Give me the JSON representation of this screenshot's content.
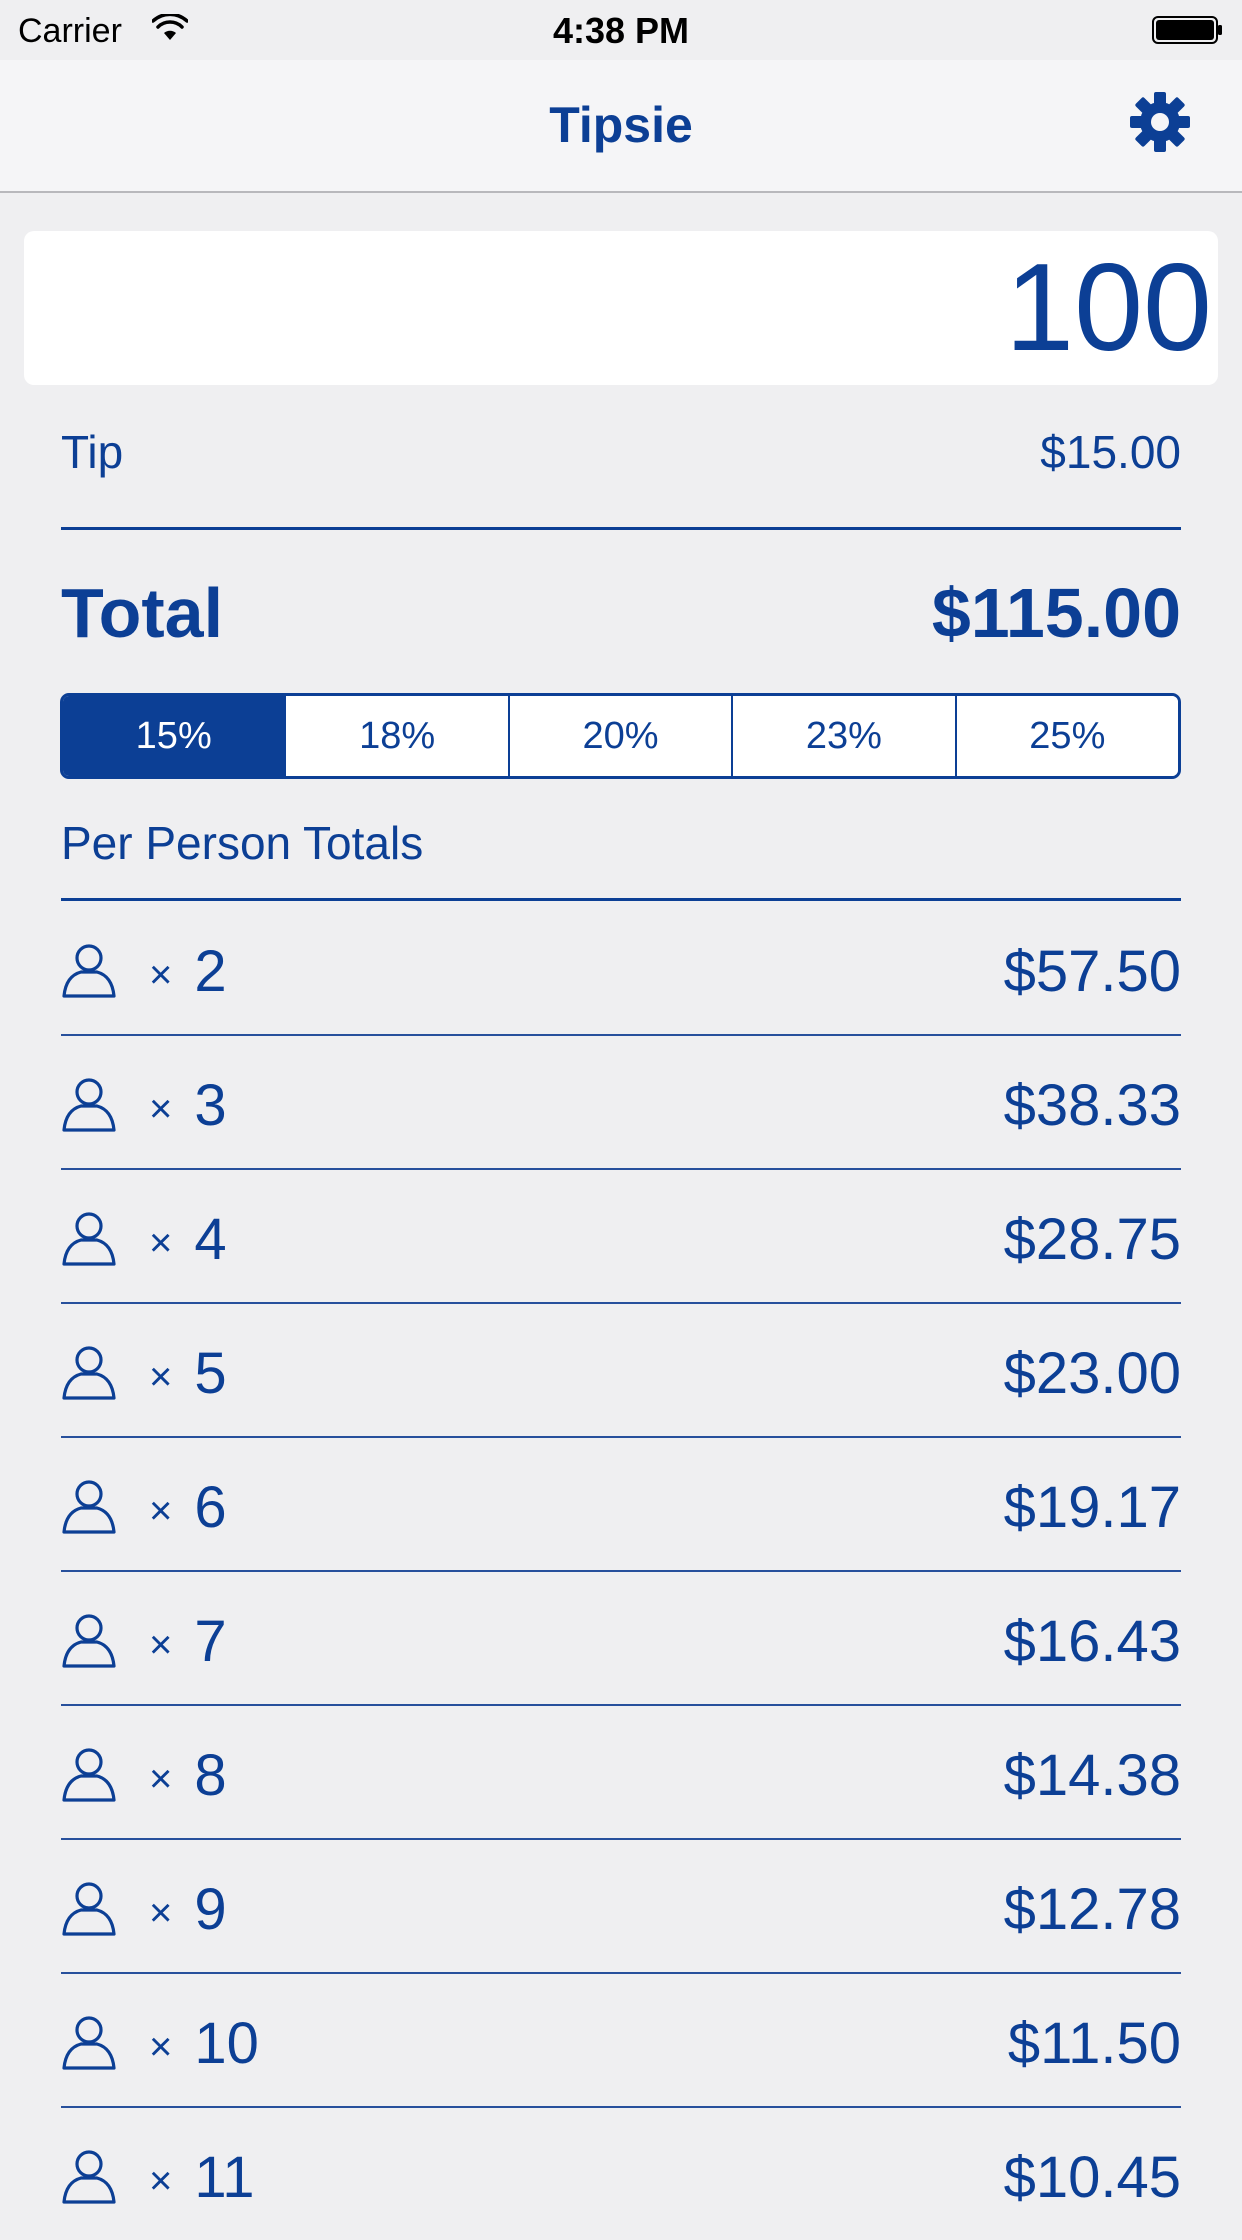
{
  "status_bar": {
    "carrier": "Carrier",
    "time": "4:38 PM"
  },
  "nav": {
    "title": "Tipsie",
    "settings_icon": "gear-icon"
  },
  "bill": {
    "amount": "100"
  },
  "tip": {
    "label": "Tip",
    "value": "$15.00"
  },
  "total": {
    "label": "Total",
    "value": "$115.00"
  },
  "tip_options": {
    "selected": "15%",
    "items": [
      "15%",
      "18%",
      "20%",
      "23%",
      "25%"
    ]
  },
  "per_person": {
    "title": "Per Person Totals",
    "times_symbol": "×",
    "rows": [
      {
        "people": "2",
        "amount": "$57.50"
      },
      {
        "people": "3",
        "amount": "$38.33"
      },
      {
        "people": "4",
        "amount": "$28.75"
      },
      {
        "people": "5",
        "amount": "$23.00"
      },
      {
        "people": "6",
        "amount": "$19.17"
      },
      {
        "people": "7",
        "amount": "$16.43"
      },
      {
        "people": "8",
        "amount": "$14.38"
      },
      {
        "people": "9",
        "amount": "$12.78"
      },
      {
        "people": "10",
        "amount": "$11.50"
      },
      {
        "people": "11",
        "amount": "$10.45"
      }
    ]
  },
  "colors": {
    "accent": "#0c3f95",
    "background": "#efeff1"
  }
}
